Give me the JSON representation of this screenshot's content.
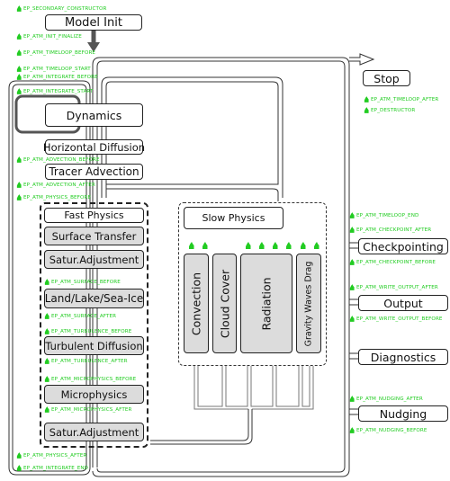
{
  "diagram": {
    "main_blocks": {
      "model_init": "Model Init",
      "stop": "Stop",
      "dynamics": "Dynamics",
      "horizontal_diffusion": "Horizontal Diffusion",
      "tracer_advection": "Tracer Advection"
    },
    "fast_physics": {
      "title": "Fast Physics",
      "processes": [
        "Surface Transfer",
        "Satur.Adjustment",
        "Land/Lake/Sea-Ice",
        "Turbulent Diffusion",
        "Microphysics",
        "Satur.Adjustment"
      ]
    },
    "slow_physics": {
      "title": "Slow Physics",
      "processes": [
        "Convection",
        "Cloud Cover",
        "Radiation",
        "Gravity Waves Drag"
      ]
    },
    "output_blocks": [
      "Checkpointing",
      "Output",
      "Diagnostics",
      "Nudging"
    ],
    "entry_points": {
      "secondary_constructor": "EP_SECONDARY_CONSTRUCTOR",
      "init_finalize": "EP_ATM_INIT_FINALIZE",
      "timeloop_before": "EP_ATM_TIMELOOP_BEFORE",
      "timeloop_start": "EP_ATM_TIMELOOP_START",
      "integrate_before": "EP_ATM_INTEGRATE_BEFORE",
      "integrate_start": "EP_ATM_INTEGRATE_START",
      "advection_before": "EP_ATM_ADVECTION_BEFORE",
      "advection_after": "EP_ATM_ADVECTION_AFTER",
      "physics_before": "EP_ATM_PHYSICS_BEFORE",
      "surface_before": "EP_ATM_SURFACE_BEFORE",
      "surface_after": "EP_ATM_SURFACE_AFTER",
      "turbulence_before": "EP_ATM_TURBULENCE_BEFORE",
      "turbulence_after": "EP_ATM_TURBULENCE_AFTER",
      "microphysics_before": "EP_ATM_MICROPHYSICS_BEFORE",
      "microphysics_after": "EP_ATM_MICROPHYSICS_AFTER",
      "physics_after": "EP_ATM_PHYSICS_AFTER",
      "integrate_end": "EP_ATM_INTEGRATE_END",
      "timeloop_after": "EP_ATM_TIMELOOP_AFTER",
      "destructor": "EP_DESTRUCTOR",
      "timeloop_end": "EP_ATM_TIMELOOP_END",
      "checkpoint_after": "EP_ATM_CHECKPOINT_AFTER",
      "checkpoint_before": "EP_ATM_CHECKPOINT_BEFORE",
      "write_output_after": "EP_ATM_WRITE_OUTPUT_AFTER",
      "write_output_before": "EP_ATM_WRITE_OUTPUT_BEFORE",
      "nudging_after": "EP_ATM_NUDGING_AFTER",
      "nudging_before": "EP_ATM_NUDGING_BEFORE"
    },
    "colors": {
      "entry_point": "#22cc22",
      "process_fill": "#dcdcdc",
      "outline": "#222222"
    }
  }
}
